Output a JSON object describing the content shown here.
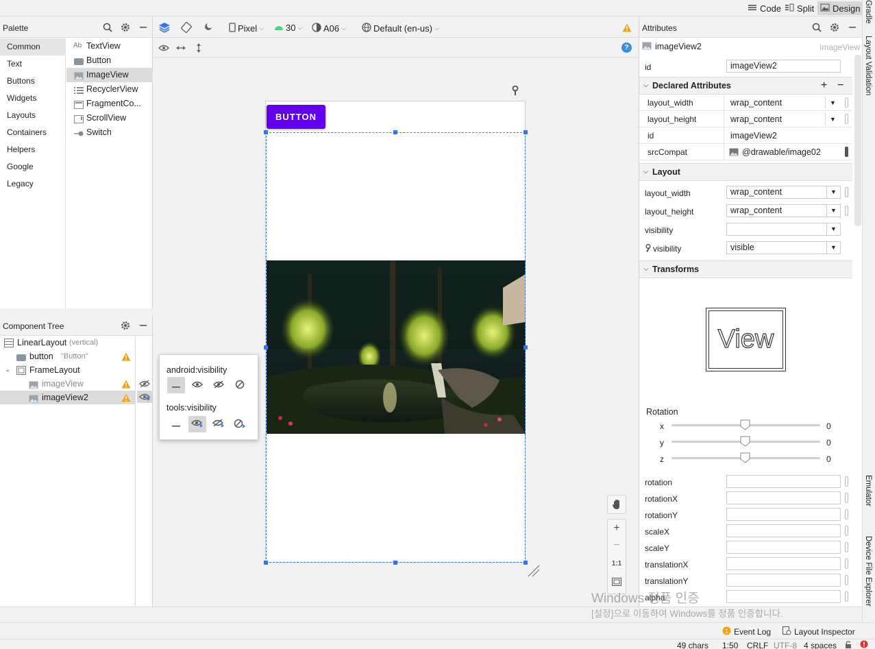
{
  "modes": {
    "code": "Code",
    "split": "Split",
    "design": "Design"
  },
  "right_strip": {
    "gradle": "Gradle",
    "layout_validation": "Layout Validation",
    "emulator": "Emulator",
    "device_file_explorer": "Device File Explorer"
  },
  "palette": {
    "title": "Palette",
    "categories": [
      "Common",
      "Text",
      "Buttons",
      "Widgets",
      "Layouts",
      "Containers",
      "Helpers",
      "Google",
      "Legacy"
    ],
    "items": [
      {
        "label": "TextView",
        "icon": "textview-icon"
      },
      {
        "label": "Button",
        "icon": "button-icon"
      },
      {
        "label": "ImageView",
        "icon": "imageview-icon"
      },
      {
        "label": "RecyclerView",
        "icon": "recyclerview-icon"
      },
      {
        "label": "FragmentCo...",
        "icon": "fragment-icon"
      },
      {
        "label": "ScrollView",
        "icon": "scrollview-icon"
      },
      {
        "label": "Switch",
        "icon": "switch-icon"
      }
    ]
  },
  "component_tree": {
    "title": "Component Tree",
    "rows": [
      {
        "label": "LinearLayout",
        "hint": "(vertical)"
      },
      {
        "label": "button",
        "hint": "\"Button\""
      },
      {
        "label": "FrameLayout",
        "hint": ""
      },
      {
        "label": "imageView",
        "hint": ""
      },
      {
        "label": "imageView2",
        "hint": ""
      }
    ]
  },
  "visibility_popup": {
    "android_label": "android:visibility",
    "tools_label": "tools:visibility"
  },
  "design_toolbar": {
    "device": "Pixel",
    "api": "30",
    "theme": "A06",
    "locale": "Default (en-us)"
  },
  "canvas": {
    "button_text": "BUTTON"
  },
  "attributes": {
    "title": "Attributes",
    "component_name": "imageView2",
    "component_type": "ImageView",
    "id_label": "id",
    "id_value": "imageView2",
    "declared_title": "Declared Attributes",
    "declared": [
      {
        "name": "layout_width",
        "value": "wrap_content"
      },
      {
        "name": "layout_height",
        "value": "wrap_content"
      },
      {
        "name": "id",
        "value": "imageView2"
      },
      {
        "name": "srcCompat",
        "value": "@drawable/image02"
      }
    ],
    "layout_title": "Layout",
    "layout": [
      {
        "name": "layout_width",
        "value": "wrap_content"
      },
      {
        "name": "layout_height",
        "value": "wrap_content"
      },
      {
        "name": "visibility",
        "value": ""
      },
      {
        "name": "visibility",
        "value": "visible"
      }
    ],
    "transforms_title": "Transforms",
    "view_preview": "View",
    "rotation_label": "Rotation",
    "rotation_axes": [
      {
        "axis": "x",
        "value": "0"
      },
      {
        "axis": "y",
        "value": "0"
      },
      {
        "axis": "z",
        "value": "0"
      }
    ],
    "transform_fields": [
      "rotation",
      "rotationX",
      "rotationY",
      "scaleX",
      "scaleY",
      "translationX",
      "translationY",
      "alpha"
    ]
  },
  "event_bar": {
    "event_log": "Event Log",
    "layout_inspector": "Layout Inspector"
  },
  "status_bar": {
    "chars": "49 chars",
    "position": "1:50",
    "line_sep": "CRLF",
    "encoding": "UTF-8",
    "indent": "4 spaces"
  },
  "watermark": {
    "line1": "Windows 정품 인증",
    "line2": "[설정]으로 이동하여 Windows를 정품 인증합니다."
  },
  "colors": {
    "accent": "#3574f0",
    "button_purple": "#6200ee",
    "warning": "#f0a30a"
  }
}
